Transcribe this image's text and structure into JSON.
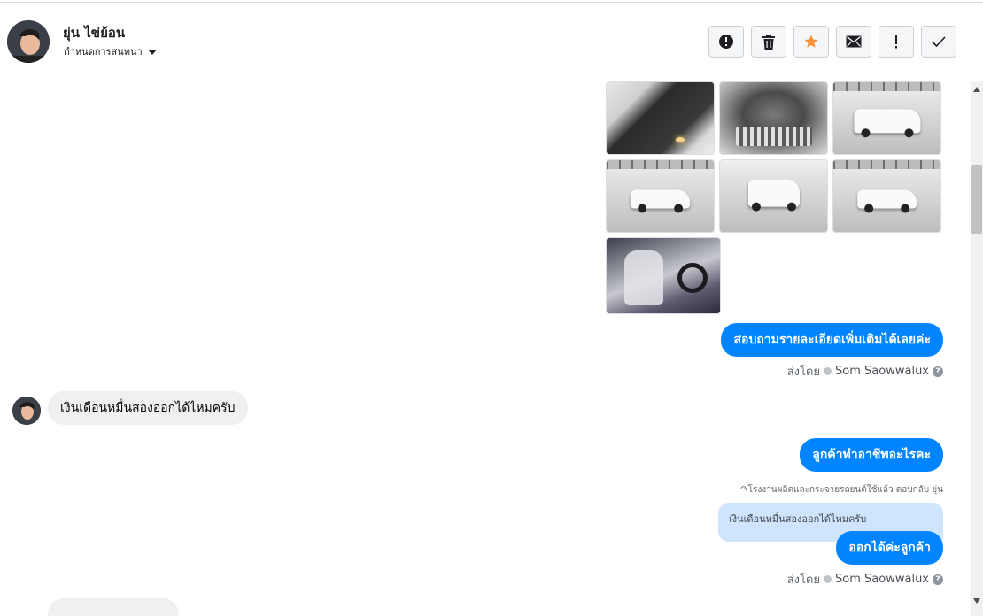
{
  "header": {
    "contact_name": "ยุ่น ไข่ย้อน",
    "assign_label": "กำหนดการสนทนา"
  },
  "toolbar": {
    "buttons": [
      {
        "name": "report-button",
        "icon": "alert-circle-icon"
      },
      {
        "name": "delete-button",
        "icon": "trash-icon"
      },
      {
        "name": "star-button",
        "icon": "star-icon",
        "color": "#f7923b"
      },
      {
        "name": "mark-unread-button",
        "icon": "envelope-icon"
      },
      {
        "name": "mark-spam-button",
        "icon": "exclamation-icon"
      },
      {
        "name": "mark-done-button",
        "icon": "checkmark-icon"
      }
    ]
  },
  "messages": {
    "m1": "สอบถามรายละเอียดเพิ่มเติมได้เลยค่ะ",
    "m2": "เงินเดือนหมื่นสองออกได้ไหมครับ",
    "m3": "ลูกค้าทำอาชีพอะไรคะ",
    "reply_note": "โรงงานผลิตและกระจายรถยนต์ใช้แล้ว ตอบกลับ ยุ่น",
    "quoted": "เงินเดือนหมื่นสองออกได้ไหมครับ",
    "m4": "ออกได้ค่ะลูกค้า"
  },
  "sent_by": {
    "prefix": "ส่งโดย",
    "agent": "Som Saowwalux",
    "help": "?"
  },
  "colors": {
    "outgoing_bubble": "#0084ff",
    "incoming_bubble": "#f1f0f0",
    "quoted_bubble": "#cfe4fd",
    "star": "#f7923b"
  }
}
